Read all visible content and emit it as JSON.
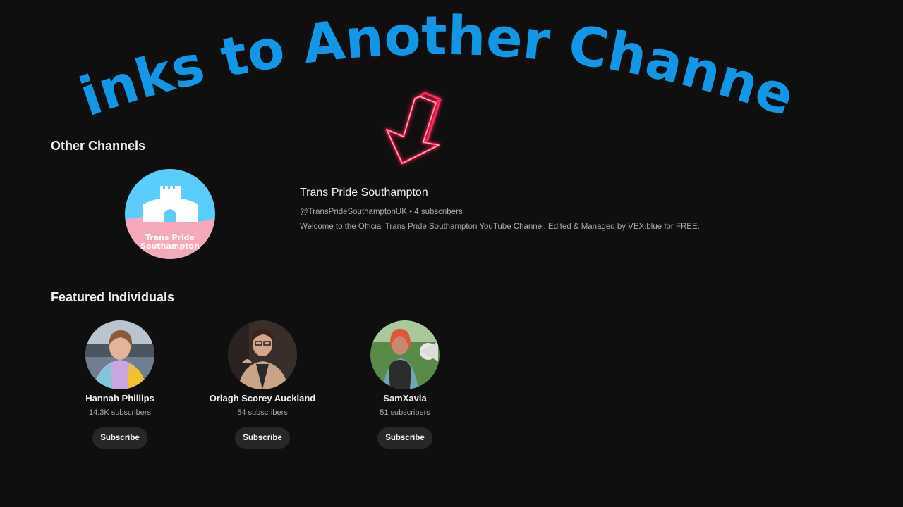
{
  "overlay": {
    "headline": "Links to Another Channel",
    "headline_color": "#1296e6",
    "arrow_color": "#ff2a5a",
    "arrow_icon": "neon-arrow-down-left"
  },
  "other_channels": {
    "title": "Other Channels",
    "channel": {
      "name": "Trans Pride Southampton",
      "meta": "@TransPrideSouthamptonUK • 4 subscribers",
      "description": "Welcome to the Official Trans Pride Southampton YouTube Channel. Edited & Managed by VEX.blue for FREE.",
      "avatar_text_line1": "Trans Pride",
      "avatar_text_line2": "Southampton",
      "avatar_colors": {
        "sky": "#5bcdfa",
        "ground": "#f5a9b8",
        "castle": "#ffffff"
      }
    }
  },
  "featured": {
    "title": "Featured Individuals",
    "people": [
      {
        "name": "Hannah Phillips",
        "subscribers": "14.3K subscribers",
        "subscribe_label": "Subscribe"
      },
      {
        "name": "Orlagh Scorey Auckland",
        "subscribers": "54 subscribers",
        "subscribe_label": "Subscribe"
      },
      {
        "name": "SamXavia",
        "subscribers": "51 subscribers",
        "subscribe_label": "Subscribe"
      }
    ]
  }
}
